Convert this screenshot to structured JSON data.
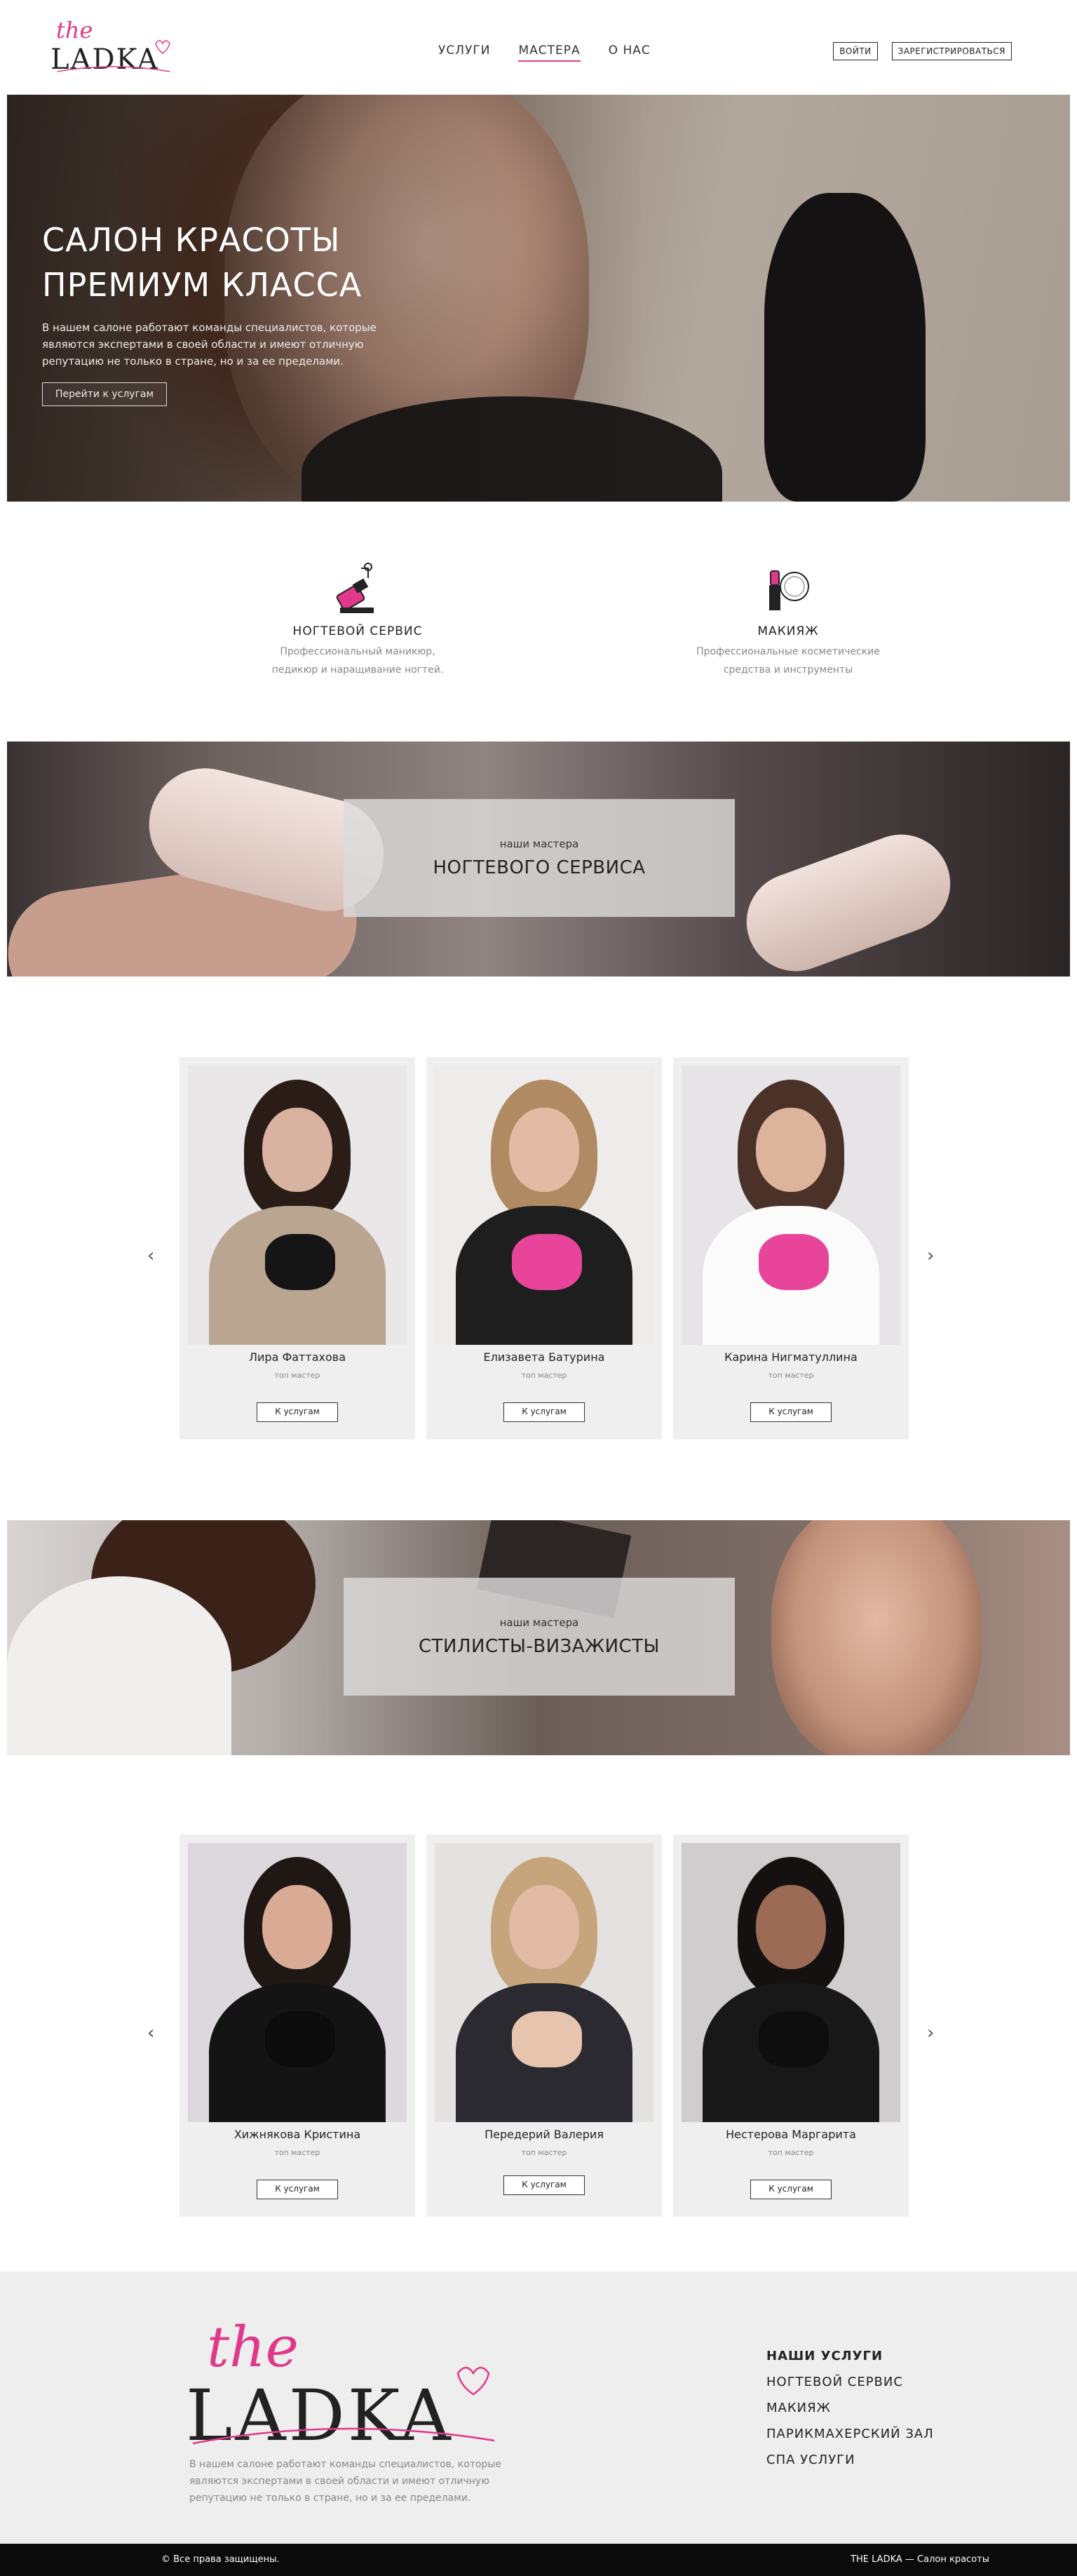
{
  "brand": {
    "logo_script": "the",
    "logo_word": "LADKA",
    "accent": "#e0398a"
  },
  "nav": {
    "items": [
      "УСЛУГИ",
      "МАСТЕРА",
      "О НАС"
    ],
    "active": "МАСТЕРА"
  },
  "auth": {
    "login": "ВОЙТИ",
    "register": "ЗАРЕГИСТРИРОВАТЬСЯ"
  },
  "hero": {
    "title_line1": "САЛОН КРАСОТЫ",
    "title_line2": "ПРЕМИУМ КЛАССА",
    "text": "В нашем салоне работают команды специалистов, которые являются экспертами в своей области и имеют отличную репутацию не только в стране, но и за ее пределами.",
    "button": "Перейти к услугам"
  },
  "services": [
    {
      "title": "НОГТЕВОЙ СЕРВИС",
      "line1": "Профессиональный маникюр,",
      "line2": "педикюр и наращивание ногтей.",
      "icon": "nail-polish-icon"
    },
    {
      "title": "МАКИЯЖ",
      "line1": "Профессиональные косметические",
      "line2": "средства и инструменты",
      "icon": "lipstick-mirror-icon"
    }
  ],
  "banner_nails": {
    "small": "наши мастера",
    "big": "НОГТЕВОГО СЕРВИСА"
  },
  "banner_makeup": {
    "small": "наши мастера",
    "big": "СТИЛИСТЫ-ВИЗАЖИСТЫ"
  },
  "nail_masters": [
    {
      "name": "Лира Фаттахова",
      "role": "топ мастер",
      "button": "К услугам"
    },
    {
      "name": "Елизавета Батурина",
      "role": "топ мастер",
      "button": "К услугам"
    },
    {
      "name": "Карина Нигматуллина",
      "role": "топ мастер",
      "button": "К услугам"
    }
  ],
  "makeup_masters": [
    {
      "name": "Хижнякова Кристина",
      "role": "топ мастер",
      "button": "К услугам"
    },
    {
      "name": "Передерий Валерия",
      "role": "топ мастер",
      "button": "К услугам"
    },
    {
      "name": "Нестерова Маргарита",
      "role": "топ мастер",
      "button": "К услугам"
    }
  ],
  "arrows": {
    "prev": "‹",
    "next": "›"
  },
  "footer": {
    "text": "В нашем салоне работают команды специалистов, которые являются экспертами в своей области и имеют отличную репутацию не только в стране, но и за ее пределами.",
    "links_head": "НАШИ УСЛУГИ",
    "links": [
      "НОГТЕВОЙ СЕРВИС",
      "МАКИЯЖ",
      "ПАРИКМАХЕРСКИЙ ЗАЛ",
      "СПА УСЛУГИ"
    ],
    "copyright": "© Все права защищены.",
    "tagline": "THE LADKA — Салон красоты"
  }
}
